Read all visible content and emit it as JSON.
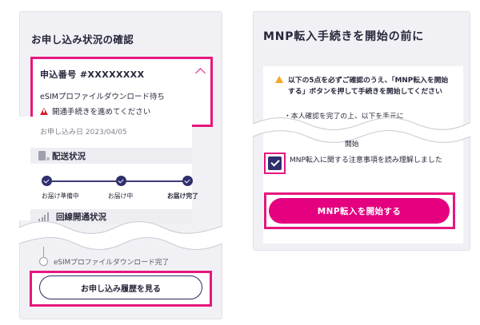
{
  "left": {
    "title": "お申し込み状況の確認",
    "application": {
      "number": "申込番号 #XXXXXXXX",
      "status": "eSIMプロファイルダウンロード待ち",
      "warning": "開通手続きを進めてください"
    },
    "order_date": "お申し込み日 2023/04/05",
    "delivery": {
      "heading": "配送状況",
      "steps": [
        {
          "label": "お届け準備中",
          "done": true,
          "bold": false
        },
        {
          "label": "お届け中",
          "done": true,
          "bold": false
        },
        {
          "label": "お届け完了",
          "done": true,
          "bold": true
        }
      ]
    },
    "activation": {
      "heading": "回線開通状況",
      "step_esim": "eSIMプロファイルダウンロード完了"
    },
    "history_button": "お申し込み履歴を見る"
  },
  "right": {
    "title": "MNP転入手続きを開始の前に",
    "notice": "以下の5点を必ずご確認のうえ、「MNP転入を開始する」ボタンを押して手続きを開始してください",
    "bullet_partial": "・本人確認を完了の上、以下を手元に",
    "kaishi_label": "開始",
    "agree_checkbox": {
      "checked": true,
      "label": "MNP転入に関する注意事項を読み理解しました"
    },
    "mnp_button": "MNP転入を開始する"
  },
  "colors": {
    "highlight": "#e6177e",
    "primary_button": "#e4007f",
    "navy": "#2e2f6e",
    "warning_red": "#d71f2b",
    "warning_amber": "#f5a623",
    "panel_bg": "#f1f1f5"
  },
  "icons": [
    "chevron-up-icon",
    "alert-triangle-icon",
    "phone-delivery-icon",
    "check-icon",
    "signal-bars-icon",
    "warning-icon"
  ]
}
